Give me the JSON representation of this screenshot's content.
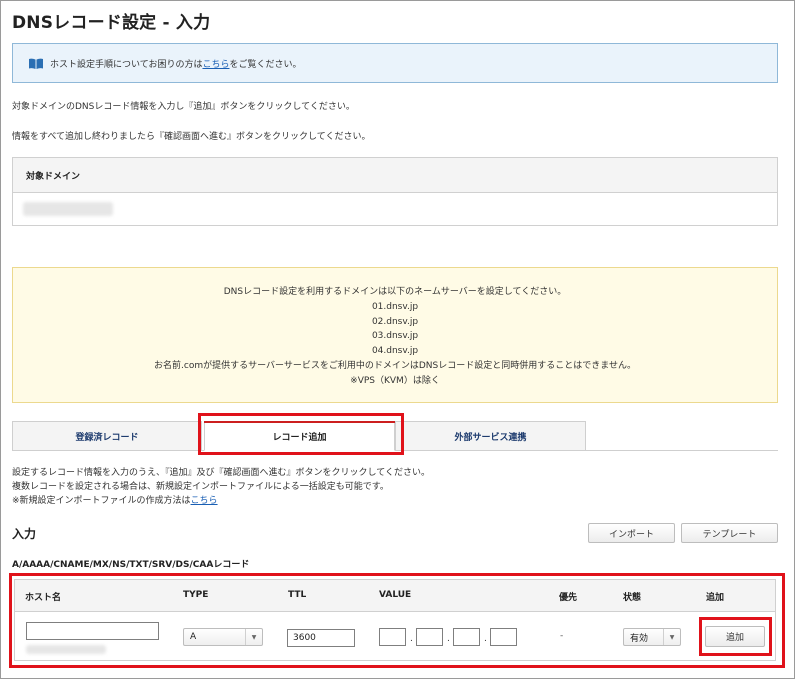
{
  "page": {
    "title": "DNSレコード設定 - 入力"
  },
  "info": {
    "text_before": "ホスト設定手順についてお困りの方は",
    "link": "こちら",
    "text_after": "をご覧ください。"
  },
  "instructions": [
    "対象ドメインのDNSレコード情報を入力し『追加』ボタンをクリックしてください。",
    "情報をすべて追加し終わりましたら『確認画面へ進む』ボタンをクリックしてください。"
  ],
  "domain": {
    "header": "対象ドメイン"
  },
  "notice": {
    "lines": [
      "DNSレコード設定を利用するドメインは以下のネームサーバーを設定してください。",
      "01.dnsv.jp",
      "02.dnsv.jp",
      "03.dnsv.jp",
      "04.dnsv.jp",
      "お名前.comが提供するサーバーサービスをご利用中のドメインはDNSレコード設定と同時併用することはできません。",
      "※VPS（KVM）は除く"
    ]
  },
  "tabs": [
    {
      "label": "登録済レコード"
    },
    {
      "label": "レコード追加"
    },
    {
      "label": "外部サービス連携"
    }
  ],
  "form_text": {
    "line1": "設定するレコード情報を入力のうえ、『追加』及び『確認画面へ進む』ボタンをクリックしてください。",
    "line2": "複数レコードを設定される場合は、新規設定インポートファイルによる一括設定も可能です。",
    "line3_before": "※新規設定インポートファイルの作成方法は",
    "line3_link": "こちら"
  },
  "input_section": {
    "title": "入力",
    "import_button": "インポート",
    "template_button": "テンプレート",
    "record_types": "A/AAAA/CNAME/MX/NS/TXT/SRV/DS/CAAレコード"
  },
  "table": {
    "headers": {
      "host": "ホスト名",
      "type": "TYPE",
      "ttl": "TTL",
      "value": "VALUE",
      "priority": "優先",
      "status": "状態",
      "add": "追加"
    },
    "row": {
      "host": "",
      "type": "A",
      "ttl": "3600",
      "value_parts": [
        "",
        "",
        "",
        ""
      ],
      "priority": "-",
      "status": "有効",
      "add_button": "追加"
    }
  },
  "colors": {
    "highlight": "#e0121a",
    "link": "#1a5fb4",
    "tab_text": "#1d3b6e",
    "notice_bg": "#fffbe6",
    "info_bg": "#eaf3fb"
  }
}
